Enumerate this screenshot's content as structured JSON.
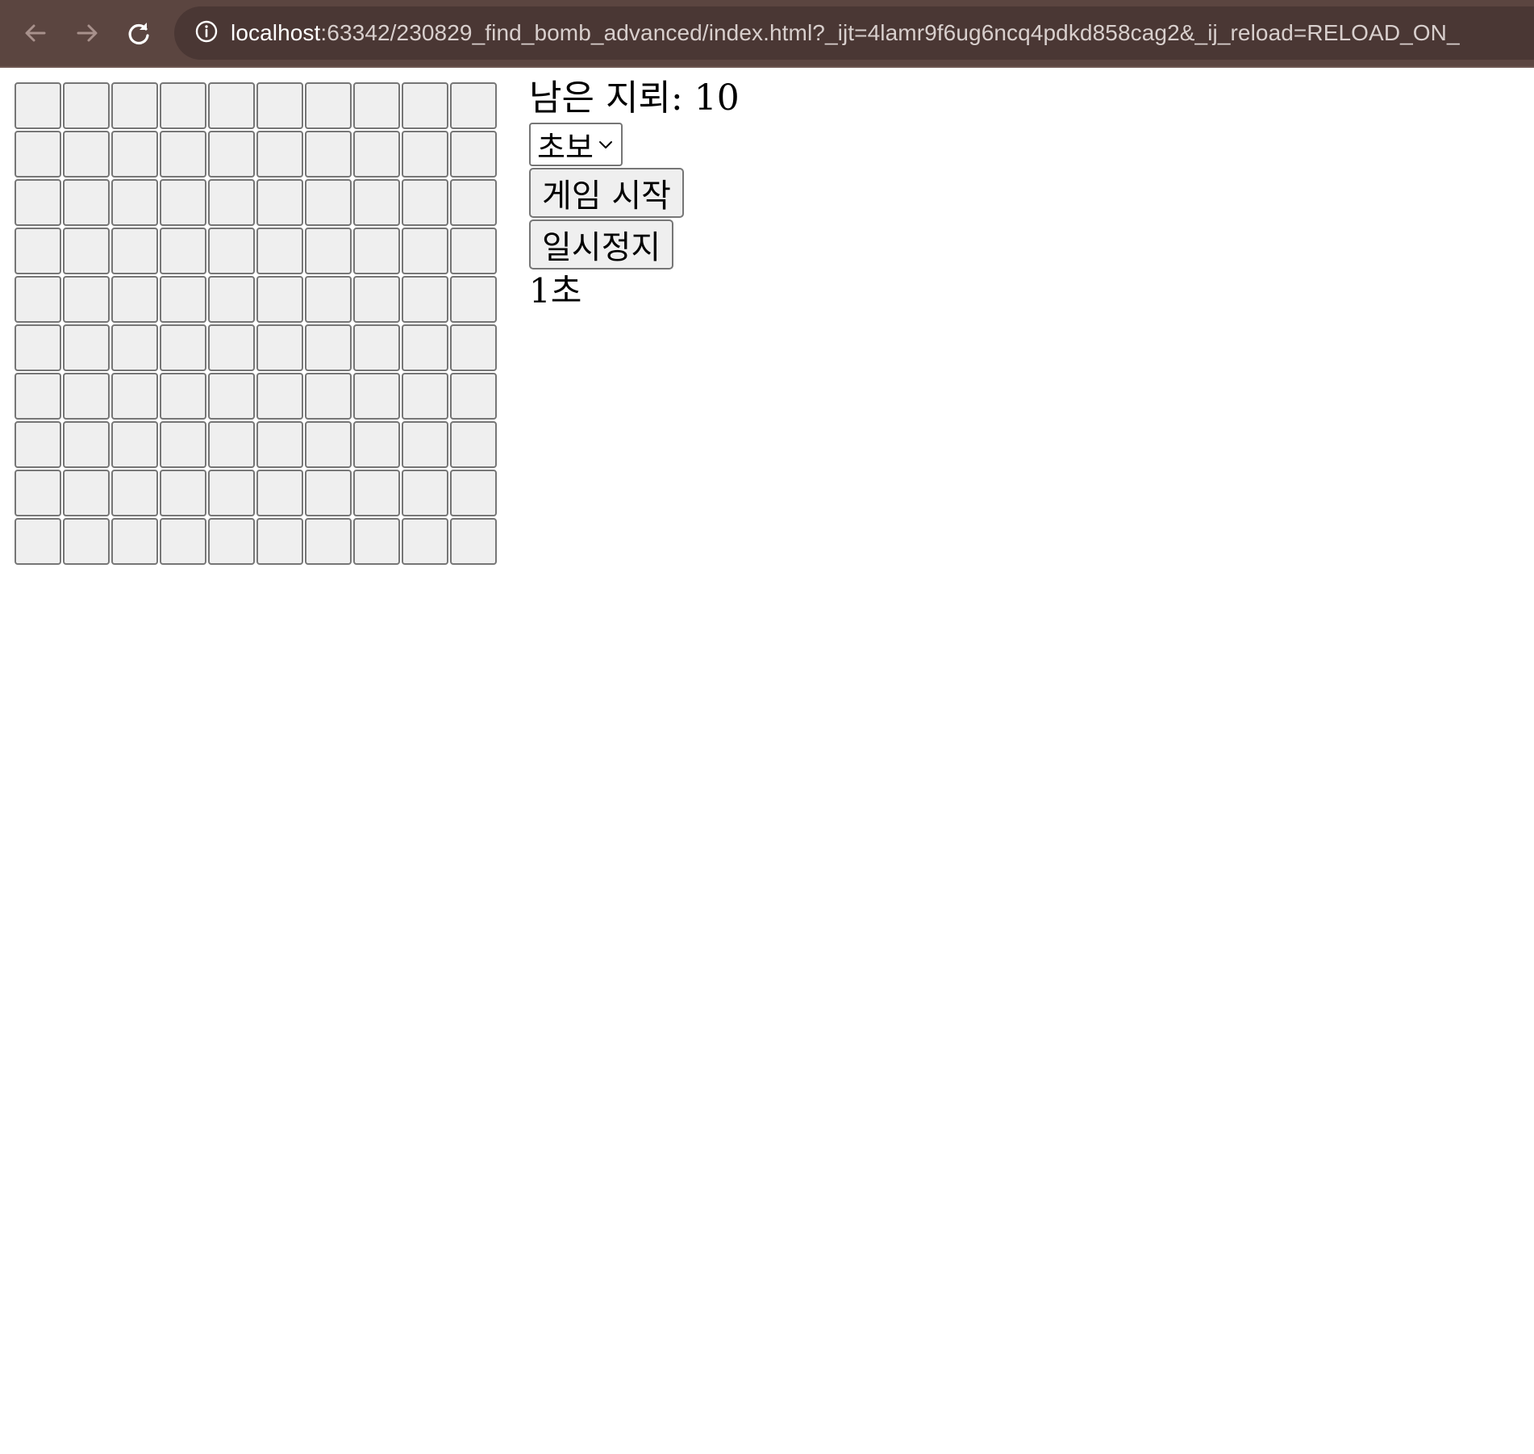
{
  "browser": {
    "url_host": "localhost",
    "url_rest": ":63342/230829_find_bomb_advanced/index.html?_ijt=4lamr9f6ug6ncq4pdkd858cag2&_ij_reload=RELOAD_ON_",
    "icons": {
      "back": "arrow-left-icon",
      "forward": "arrow-right-icon",
      "reload": "reload-icon",
      "site_info": "info-circle-icon"
    },
    "colors": {
      "toolbar": "#5b4540",
      "urlbar": "#4a3734"
    }
  },
  "game": {
    "rows": 10,
    "cols": 10,
    "mine_count_text": "남은 지뢰: 10",
    "level_select": {
      "selected": "초보"
    },
    "start_button_label": "게임 시작",
    "pause_button_label": "일시정지",
    "timer_text": "1초",
    "cell_color": "#efefef"
  }
}
